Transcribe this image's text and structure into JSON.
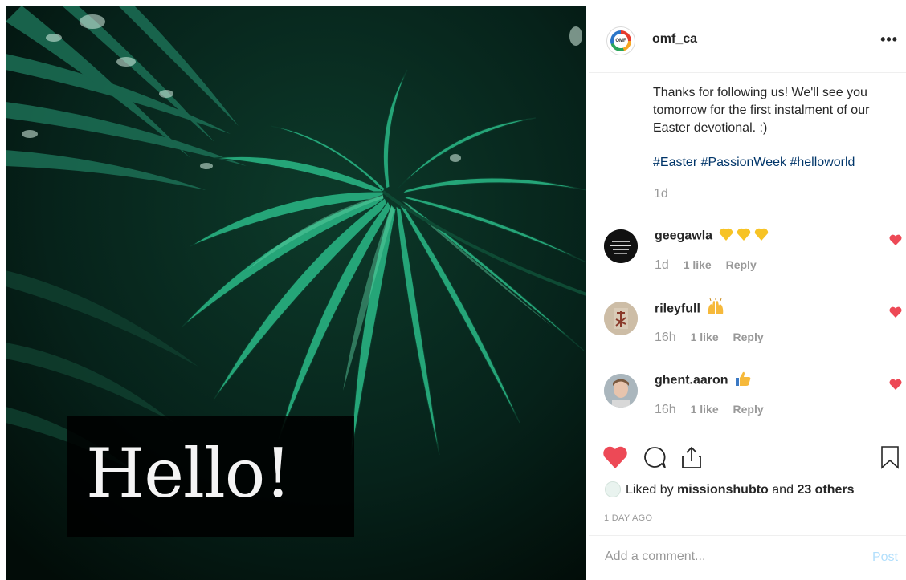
{
  "post": {
    "image_text": "Hello!",
    "author": "omf_ca",
    "author_avatar_text": "OMF",
    "more_label": "•••",
    "caption": "Thanks for following us! We'll see you tomorrow for the first instalment of our Easter devotional. :)",
    "hashtags": [
      "#Easter",
      "#PassionWeek",
      "#helloworld"
    ],
    "caption_time": "1d"
  },
  "comments": [
    {
      "user": "geegawla",
      "emoji": "yellow-hearts",
      "time": "1d",
      "likes": "1 like",
      "reply": "Reply"
    },
    {
      "user": "rileyfull",
      "emoji": "raised-hands",
      "time": "16h",
      "likes": "1 like",
      "reply": "Reply"
    },
    {
      "user": "ghent.aaron",
      "emoji": "thumbs-up",
      "time": "16h",
      "likes": "1 like",
      "reply": "Reply"
    }
  ],
  "engagement": {
    "liked_by_prefix": "Liked by",
    "liked_by_user": "missionshubto",
    "liked_by_and": "and",
    "liked_by_others": "23 others",
    "posted_ago": "1 DAY AGO"
  },
  "comment_box": {
    "placeholder": "Add a comment...",
    "post_label": "Post"
  },
  "colors": {
    "like_red": "#ed4956",
    "link_blue": "#003569",
    "post_disabled": "#b2dffc",
    "muted": "#999999"
  }
}
